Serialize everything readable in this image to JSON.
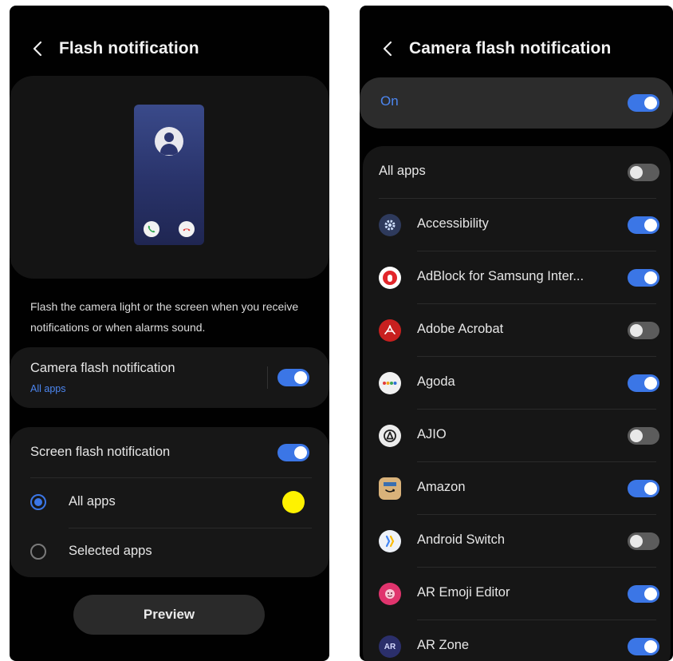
{
  "left_screen": {
    "title": "Flash notification",
    "description": "Flash the camera light or the screen when you receive notifications or when alarms sound.",
    "camera_flash": {
      "title": "Camera flash notification",
      "subtitle": "All apps",
      "enabled": true
    },
    "screen_flash": {
      "title": "Screen flash notification",
      "enabled": true,
      "options": [
        {
          "label": "All apps",
          "selected": true
        },
        {
          "label": "Selected apps",
          "selected": false
        }
      ],
      "selected_color": "#fff200"
    },
    "preview_label": "Preview"
  },
  "right_screen": {
    "title": "Camera flash notification",
    "master": {
      "label": "On",
      "enabled": true
    },
    "all_apps": {
      "label": "All apps",
      "enabled": false
    },
    "apps": [
      {
        "label": "Accessibility",
        "enabled": true,
        "icon": "gear-icon"
      },
      {
        "label": "AdBlock for Samsung Inter...",
        "enabled": true,
        "icon": "adblock-icon"
      },
      {
        "label": "Adobe Acrobat",
        "enabled": false,
        "icon": "acrobat-icon"
      },
      {
        "label": "Agoda",
        "enabled": true,
        "icon": "agoda-icon"
      },
      {
        "label": "AJIO",
        "enabled": false,
        "icon": "ajio-icon"
      },
      {
        "label": "Amazon",
        "enabled": true,
        "icon": "amazon-icon"
      },
      {
        "label": "Android Switch",
        "enabled": false,
        "icon": "android-switch-icon"
      },
      {
        "label": "AR Emoji Editor",
        "enabled": true,
        "icon": "ar-emoji-icon"
      },
      {
        "label": "AR Zone",
        "enabled": true,
        "icon": "ar-zone-icon",
        "icon_text": "AR"
      }
    ]
  },
  "colors": {
    "accent": "#3b76e6",
    "background": "#010101",
    "card": "#171717"
  }
}
